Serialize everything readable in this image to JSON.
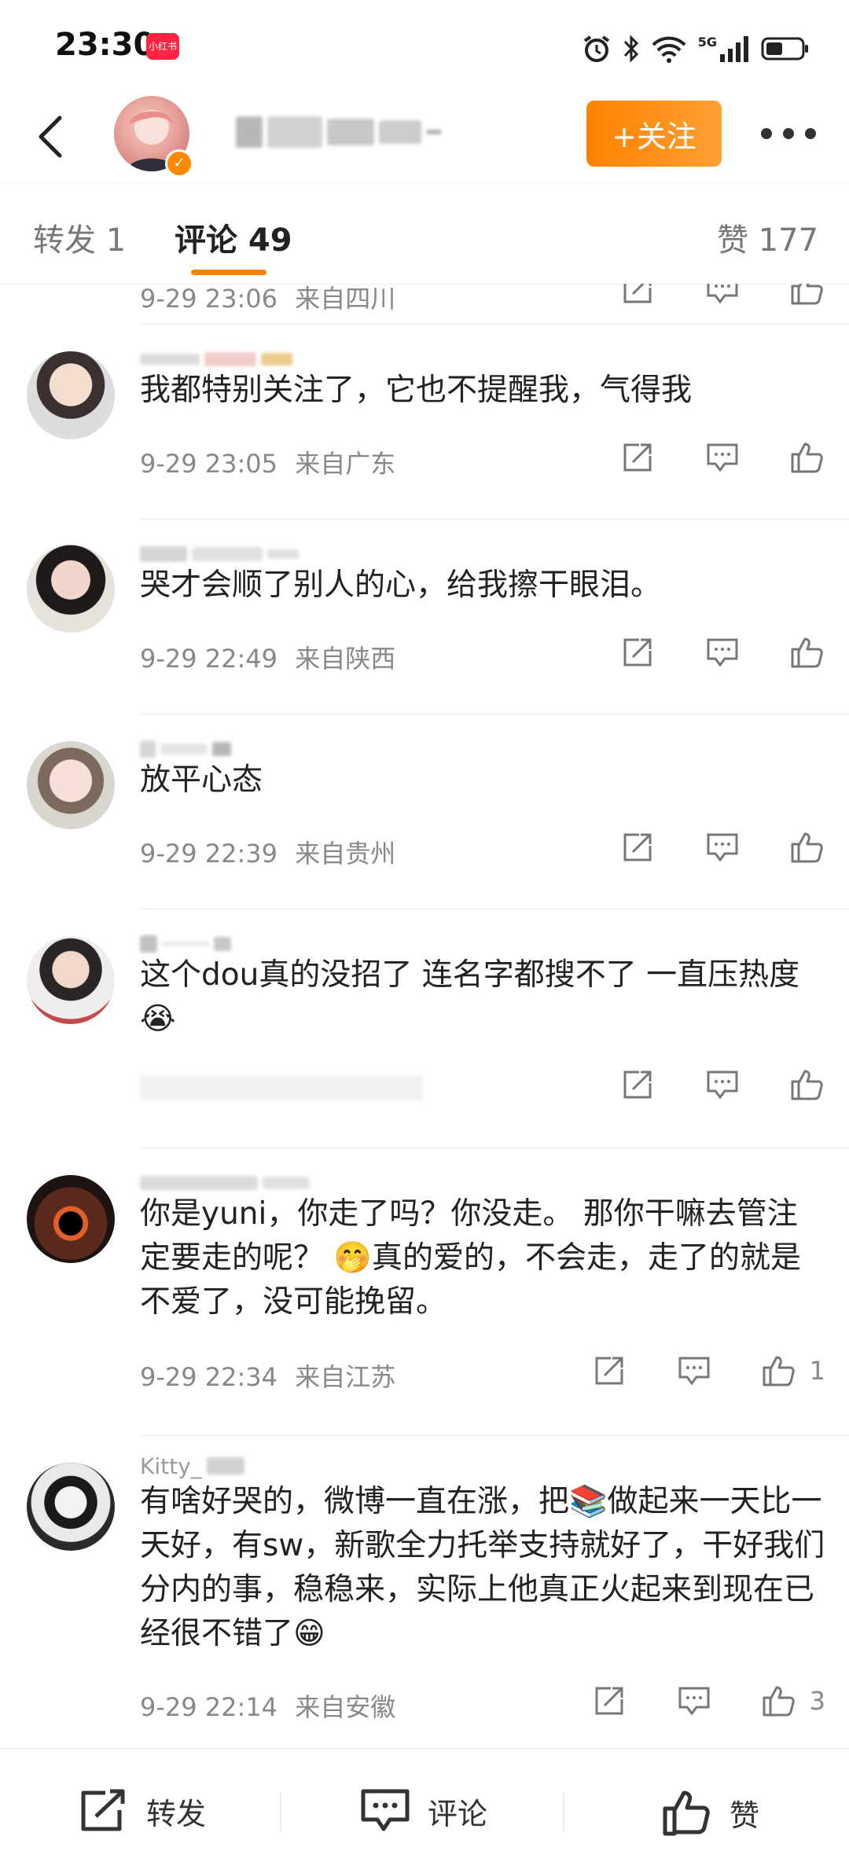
{
  "status": {
    "time": "23:30",
    "app_badge": "小红书",
    "network": "5G"
  },
  "header": {
    "follow_label": "+关注",
    "more_icon": "more-icon"
  },
  "tabs": [
    {
      "label": "转发 1"
    },
    {
      "label": "评论 49"
    },
    {
      "label": "赞 177"
    }
  ],
  "comments": [
    {
      "text": "",
      "time": "9-29 23:06",
      "location": "来自四川",
      "likes": ""
    },
    {
      "text": "我都特别关注了，它也不提醒我，气得我",
      "time": "9-29 23:05",
      "location": "来自广东",
      "likes": ""
    },
    {
      "text": "哭才会顺了别人的心，给我擦干眼泪。",
      "time": "9-29 22:49",
      "location": "来自陕西",
      "likes": ""
    },
    {
      "text": "放平心态",
      "time": "9-29 22:39",
      "location": "来自贵州",
      "likes": ""
    },
    {
      "text": "这个dou真的没招了  连名字都搜不了  一直压热度😭",
      "time": "",
      "location": "",
      "likes": ""
    },
    {
      "text": "你是yuni，你走了吗？你没走。 那你干嘛去管注定要走的呢？ 🤭真的爱的，不会走，走了的就是不爱了，没可能挽留。",
      "time": "9-29 22:34",
      "location": "来自江苏",
      "likes": "1"
    },
    {
      "name": "Kitty_",
      "text": "有啥好哭的，微博一直在涨，把📚做起来一天比一天好，有sw，新歌全力托举支持就好了，干好我们分内的事，稳稳来，实际上他真正火起来到现在已经很不错了😁",
      "time": "9-29 22:14",
      "location": "来自安徽",
      "likes": "3"
    }
  ],
  "bottom": {
    "repost": "转发",
    "comment": "评论",
    "like": "赞"
  },
  "colors": {
    "accent": "#ff8200",
    "meta": "#888888"
  }
}
